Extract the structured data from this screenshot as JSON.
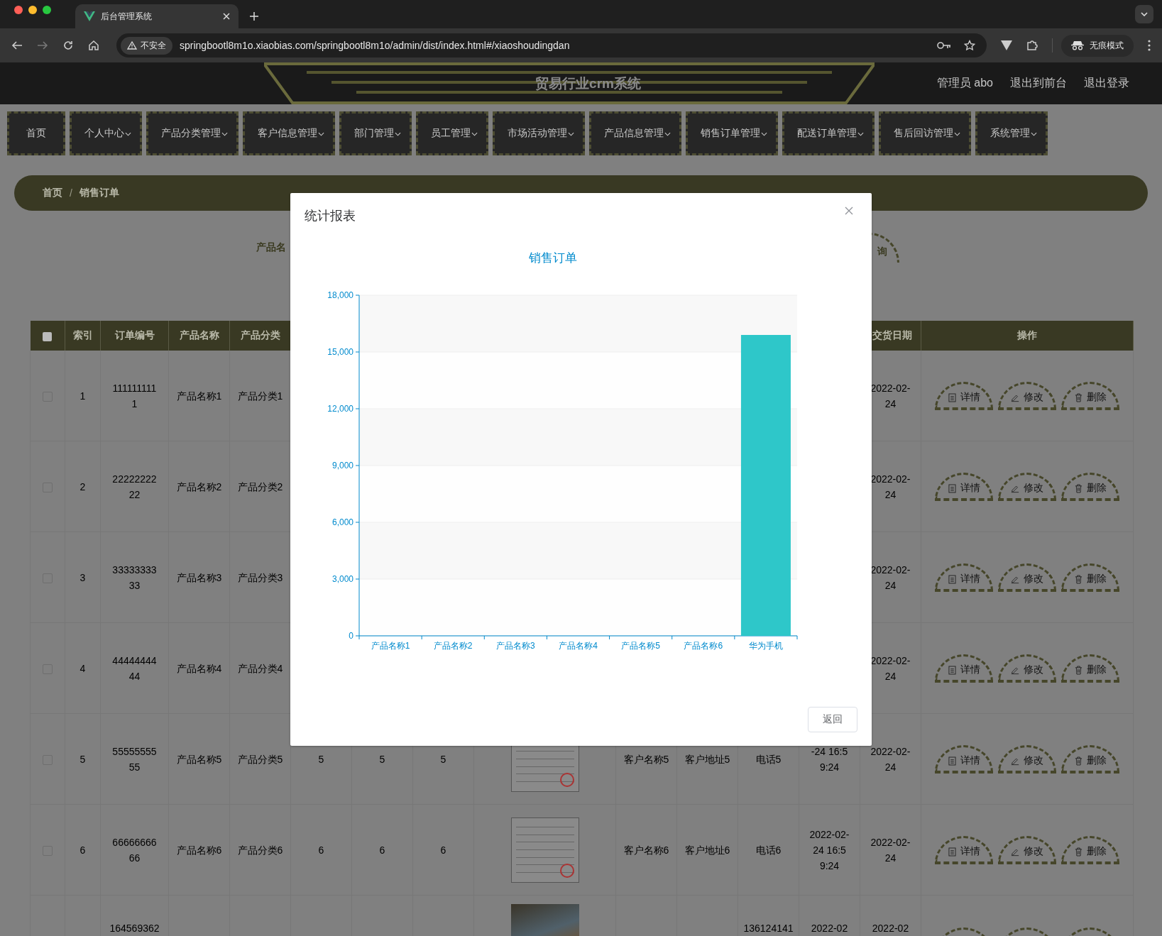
{
  "browser": {
    "tab_title": "后台管理系统",
    "security_label": "不安全",
    "url": "springbootl8m1o.xiaobias.com/springbootl8m1o/admin/dist/index.html#/xiaoshoudingdan",
    "profile_label": "无痕模式"
  },
  "header": {
    "title": "贸易行业crm系统",
    "links": [
      "管理员 abo",
      "退出到前台",
      "退出登录"
    ]
  },
  "nav": [
    {
      "label": "首页",
      "has_menu": false
    },
    {
      "label": "个人中心",
      "has_menu": true
    },
    {
      "label": "产品分类管理",
      "has_menu": true
    },
    {
      "label": "客户信息管理",
      "has_menu": true
    },
    {
      "label": "部门管理",
      "has_menu": true
    },
    {
      "label": "员工管理",
      "has_menu": true
    },
    {
      "label": "市场活动管理",
      "has_menu": true
    },
    {
      "label": "产品信息管理",
      "has_menu": true
    },
    {
      "label": "销售订单管理",
      "has_menu": true
    },
    {
      "label": "配送订单管理",
      "has_menu": true
    },
    {
      "label": "售后回访管理",
      "has_menu": true
    },
    {
      "label": "系统管理",
      "has_menu": true
    }
  ],
  "breadcrumb": {
    "items": [
      "首页",
      "销售订单"
    ],
    "separator": "/"
  },
  "search": {
    "label": "产品名",
    "button": "询"
  },
  "table": {
    "header_checkbox": {
      "checked": false
    },
    "columns": [
      "索引",
      "订单编号",
      "产品名称",
      "产品分类",
      "交货日期",
      "操作"
    ],
    "rows": [
      {
        "selected": false,
        "index": "1",
        "order_no": "1111111111",
        "product_name": "产品名称1",
        "category": "产品分类1",
        "delivery_date": "2022-02-24",
        "actions": [
          {
            "kind": "detail",
            "label": "详情"
          },
          {
            "kind": "edit",
            "label": "修改"
          },
          {
            "kind": "delete",
            "label": "删除"
          }
        ]
      },
      {
        "selected": false,
        "index": "2",
        "order_no": "2222222222",
        "product_name": "产品名称2",
        "category": "产品分类2",
        "delivery_date": "2022-02-24",
        "actions": [
          {
            "kind": "detail",
            "label": "详情"
          },
          {
            "kind": "edit",
            "label": "修改"
          },
          {
            "kind": "delete",
            "label": "删除"
          }
        ]
      },
      {
        "selected": false,
        "index": "3",
        "order_no": "3333333333",
        "product_name": "产品名称3",
        "category": "产品分类3",
        "delivery_date": "2022-02-24",
        "actions": [
          {
            "kind": "detail",
            "label": "详情"
          },
          {
            "kind": "edit",
            "label": "修改"
          },
          {
            "kind": "delete",
            "label": "删除"
          }
        ]
      },
      {
        "selected": false,
        "index": "4",
        "order_no": "4444444444",
        "product_name": "产品名称4",
        "category": "产品分类4",
        "delivery_date": "2022-02-24",
        "actions": [
          {
            "kind": "detail",
            "label": "详情"
          },
          {
            "kind": "edit",
            "label": "修改"
          },
          {
            "kind": "delete",
            "label": "删除"
          }
        ]
      },
      {
        "selected": false,
        "index": "5",
        "order_no": "5555555555",
        "product_name": "产品名称5",
        "category": "产品分类5",
        "column_6": "5",
        "column_7": "5",
        "column_8": "5",
        "image": {
          "kind": "document"
        },
        "column_10": "客户名称5",
        "column_11": "客户地址5",
        "column_12": "电话5",
        "column_13": "-24 16:59:24",
        "delivery_date": "2022-02-24",
        "actions": [
          {
            "kind": "detail",
            "label": "详情"
          },
          {
            "kind": "edit",
            "label": "修改"
          },
          {
            "kind": "delete",
            "label": "删除"
          }
        ]
      },
      {
        "selected": false,
        "index": "6",
        "order_no": "6666666666",
        "product_name": "产品名称6",
        "category": "产品分类6",
        "column_6": "6",
        "column_7": "6",
        "column_8": "6",
        "image": {
          "kind": "document"
        },
        "column_10": "客户名称6",
        "column_11": "客户地址6",
        "column_12": "电话6",
        "column_13": "2022-02-24 16:59:24",
        "delivery_date": "2022-02-24",
        "actions": [
          {
            "kind": "detail",
            "label": "详情"
          },
          {
            "kind": "edit",
            "label": "修改"
          },
          {
            "kind": "delete",
            "label": "删除"
          }
        ]
      },
      {
        "order_no": "164569362",
        "image": {
          "kind": "photo"
        },
        "column_12": "136124141",
        "column_13": "2022-02",
        "delivery_date": "2022-02",
        "actions": [
          {
            "kind": "detail"
          },
          {
            "kind": "edit"
          },
          {
            "kind": "delete"
          }
        ]
      }
    ]
  },
  "dialog": {
    "title": "统计报表",
    "button": "返回",
    "chart_data": {
      "type": "bar",
      "title": "销售订单",
      "grid": true,
      "categories": [
        "产品名称1",
        "产品名称2",
        "产品名称3",
        "产品名称4",
        "产品名称5",
        "产品名称6",
        "华为手机"
      ],
      "values": [
        0,
        0,
        0,
        0,
        0,
        0,
        15900
      ],
      "ylim": [
        0,
        18000
      ],
      "yticks": [
        {
          "value": 0,
          "label": "0"
        },
        {
          "value": 3000,
          "label": "3,000"
        },
        {
          "value": 6000,
          "label": "6,000"
        },
        {
          "value": 9000,
          "label": "9,000"
        },
        {
          "value": 12000,
          "label": "12,000"
        },
        {
          "value": 15000,
          "label": "15,000"
        },
        {
          "value": 18000,
          "label": "18,000"
        }
      ]
    }
  }
}
